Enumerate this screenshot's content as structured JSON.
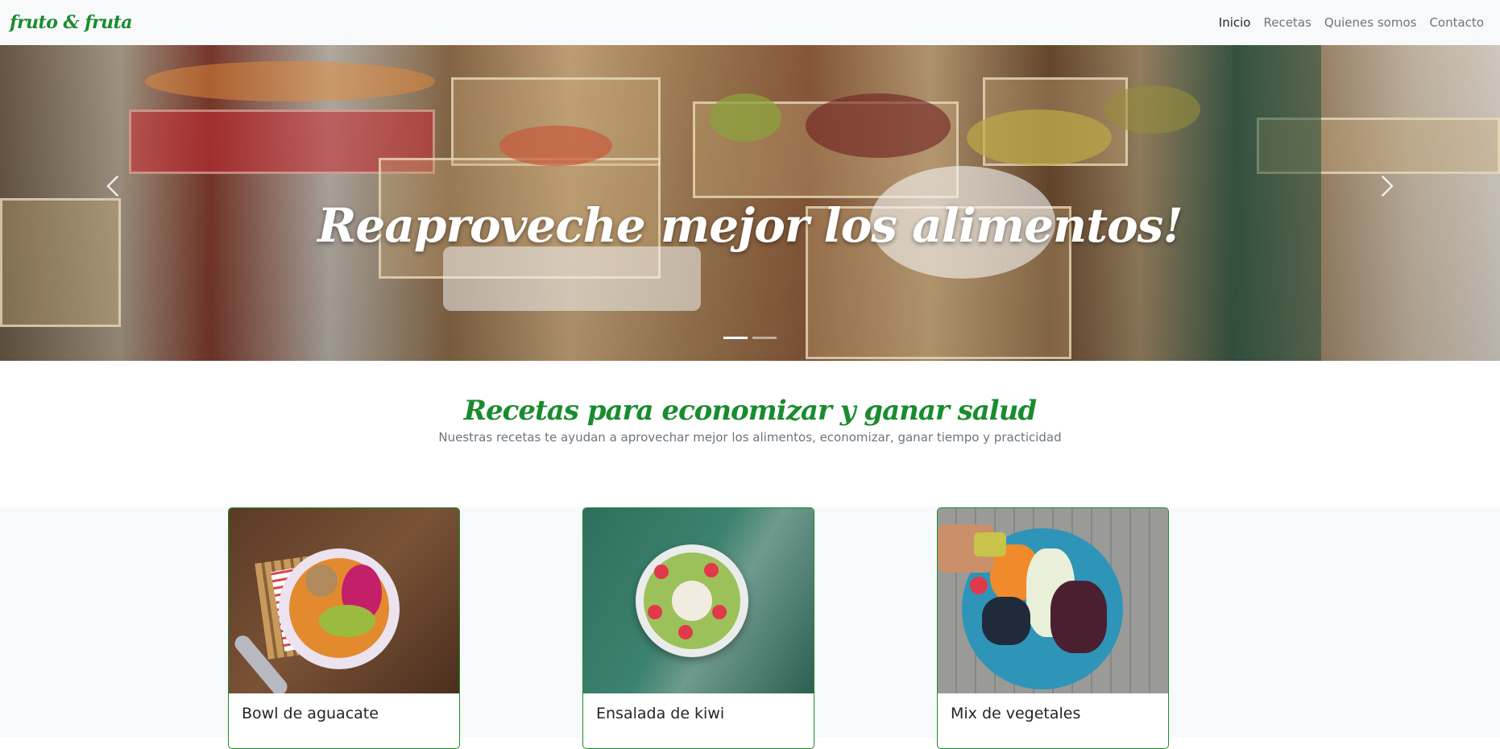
{
  "navbar": {
    "brand": "fruto & fruta",
    "links": [
      {
        "label": "Inicio",
        "active": true
      },
      {
        "label": "Recetas",
        "active": false
      },
      {
        "label": "Quienes somos",
        "active": false
      },
      {
        "label": "Contacto",
        "active": false
      }
    ]
  },
  "hero": {
    "caption": "Reaproveche mejor los alimentos!",
    "prev_icon": "chevron-left-icon",
    "next_icon": "chevron-right-icon",
    "slides_count": 2,
    "active_slide": 0
  },
  "recipes_section": {
    "title": "Recetas para economizar y ganar salud",
    "subtitle": "Nuestras recetas te ayudan a aprovechar mejor los alimentos, economizar, ganar tiempo y practicidad"
  },
  "cards": [
    {
      "title": "Bowl de aguacate",
      "text": ""
    },
    {
      "title": "Ensalada de kiwi",
      "text": ""
    },
    {
      "title": "Mix de vegetales",
      "text": ""
    }
  ],
  "colors": {
    "brand_green": "#198c2e",
    "navbar_bg": "#f8f9fa",
    "muted_text": "#6c757d"
  }
}
